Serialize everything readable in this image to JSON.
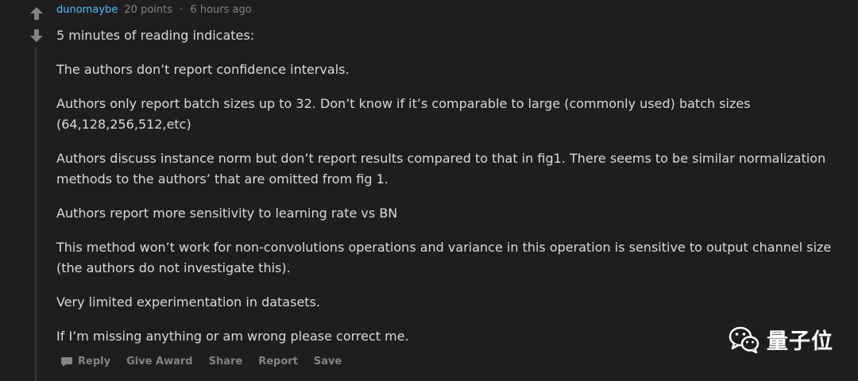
{
  "comment": {
    "author": "dunomaybe",
    "points": "20 points",
    "separator": "·",
    "time": "6 hours ago",
    "paragraphs": [
      "5 minutes of reading indicates:",
      "The authors don’t report confidence intervals.",
      "Authors only report batch sizes up to 32. Don’t know if it’s comparable to large (commonly used) batch sizes (64,128,256,512,etc)",
      "Authors discuss instance norm but don’t report results compared to that in fig1. There seems to be similar normalization methods to the authors’ that are omitted from fig 1.",
      "Authors report more sensitivity to learning rate vs BN",
      "This method won’t work for non-convolutions operations and variance in this operation is sensitive to output channel size (the authors do not investigate this).",
      "Very limited experimentation in datasets.",
      "If I’m missing anything or am wrong please correct me."
    ]
  },
  "votes": {
    "up_icon": "upvote-arrow-icon",
    "down_icon": "downvote-arrow-icon"
  },
  "actions": {
    "reply": "Reply",
    "give_award": "Give Award",
    "share": "Share",
    "report": "Report",
    "save": "Save"
  },
  "watermark": {
    "text": "量子位",
    "icon": "wechat-icon"
  },
  "colors": {
    "background": "#1e1e1e",
    "author": "#4fbcff",
    "text": "#d7dadc",
    "muted": "#818384"
  }
}
